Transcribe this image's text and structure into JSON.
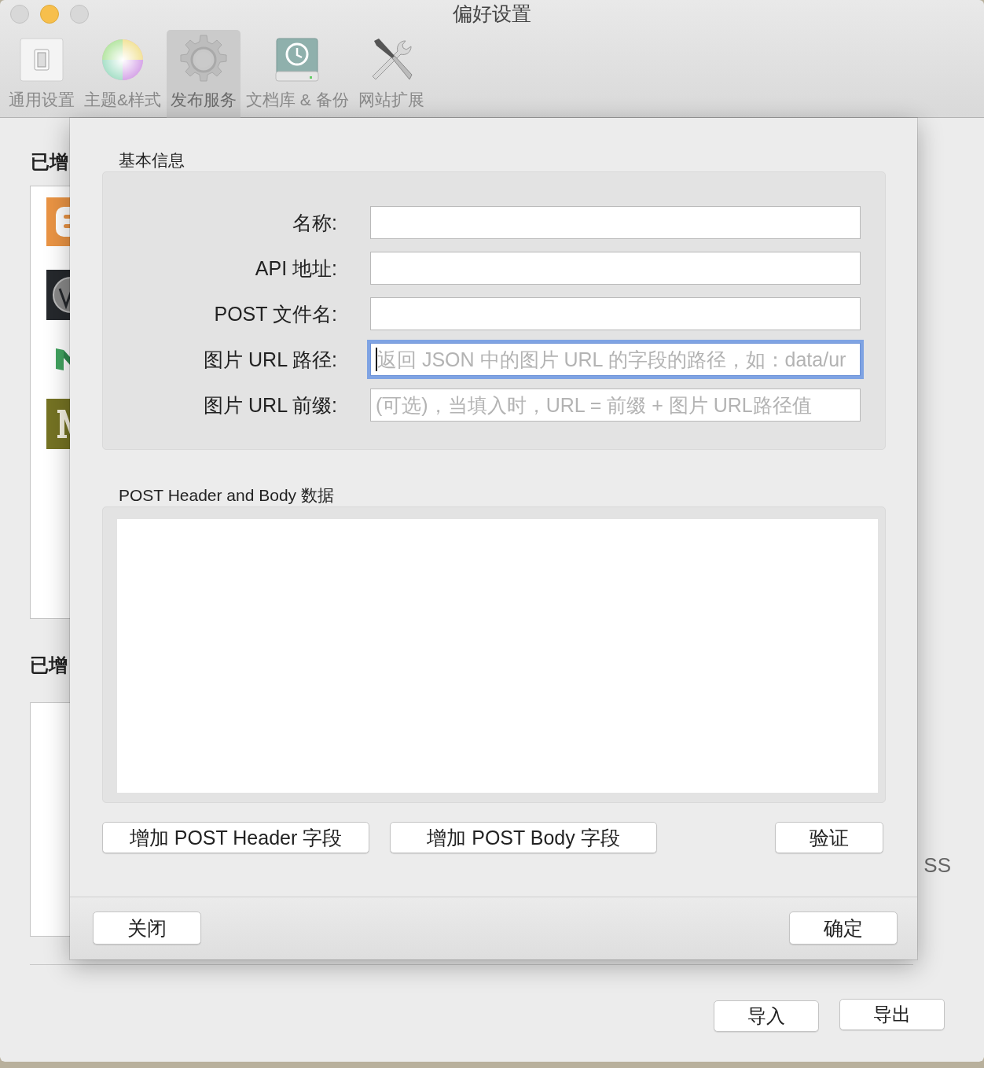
{
  "window": {
    "title": "偏好设置"
  },
  "toolbar": [
    {
      "label": "通用设置",
      "selected": false
    },
    {
      "label": "主题&样式",
      "selected": false
    },
    {
      "label": "发布服务",
      "selected": true
    },
    {
      "label": "文档库 & 备份",
      "selected": false
    },
    {
      "label": "网站扩展",
      "selected": false
    }
  ],
  "background": {
    "headings": [
      "已增",
      "已增"
    ],
    "side_text": "SS",
    "buttons": [
      "导入",
      "导出"
    ]
  },
  "dialog": {
    "section_1": "基本信息",
    "fields": [
      {
        "label": "名称:",
        "focused": false
      },
      {
        "label": "API 地址:",
        "focused": false
      },
      {
        "label": "POST 文件名:",
        "focused": false
      },
      {
        "label": "图片 URL 路径:",
        "placeholder": "返回 JSON 中的图片 URL 的字段的路径，如：data/ur",
        "focused": true
      },
      {
        "label": "图片 URL 前缀:",
        "placeholder": "(可选)，当填入时，URL = 前缀 + 图片 URL路径值",
        "focused": false
      }
    ],
    "section_2": "POST Header and Body 数据",
    "actions": [
      "增加 POST Header 字段",
      "增加 POST Body 字段",
      "验证"
    ],
    "footer": [
      "关闭",
      "确定"
    ]
  }
}
